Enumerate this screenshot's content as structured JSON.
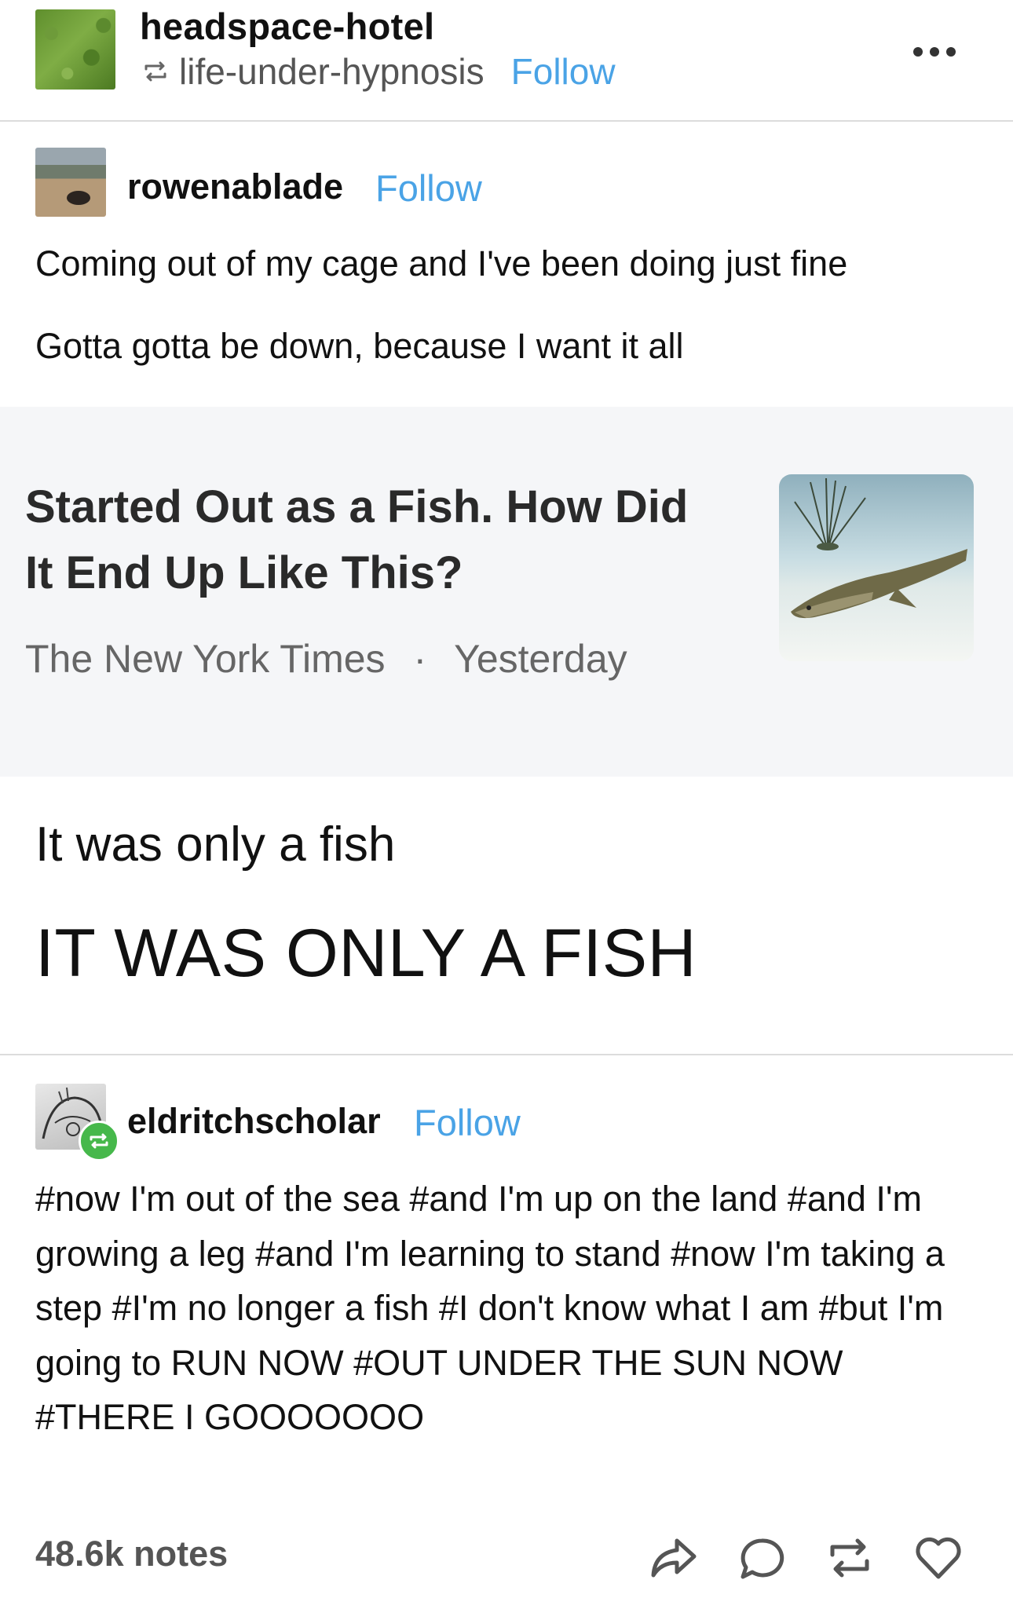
{
  "header": {
    "blog_name": "headspace-hotel",
    "reblogged_from": "life-under-hypnosis",
    "follow_label": "Follow",
    "menu_icon": "more-options-icon"
  },
  "post1": {
    "username": "rowenablade",
    "follow_label": "Follow",
    "lines": [
      "Coming out of my cage and I've been doing just fine",
      "Gotta gotta be down, because I want it all"
    ],
    "link_card": {
      "title": "Started Out as a Fish. How Did It End Up Like This?",
      "source": "The New York Times",
      "separator": "·",
      "time": "Yesterday"
    },
    "after_lines": [
      "It was only a fish",
      "IT WAS ONLY A FISH"
    ]
  },
  "post2": {
    "username": "eldritchscholar",
    "follow_label": "Follow",
    "tags": "#now I'm out of the sea #and I'm up on the land #and I'm growing a leg #and I'm learning to stand #now I'm taking a step #I'm no longer a fish #I don't know what I am #but I'm going to RUN NOW #OUT UNDER THE SUN NOW #THERE I GOOOOOOO"
  },
  "footer": {
    "notes": "48.6k notes",
    "icons": [
      "share-icon",
      "reply-icon",
      "reblog-icon",
      "like-icon"
    ]
  },
  "colors": {
    "follow": "#4aa3e6",
    "reblog_badge": "#46b84b",
    "card_bg": "#f5f6f8",
    "divider": "#dcdcdc"
  }
}
